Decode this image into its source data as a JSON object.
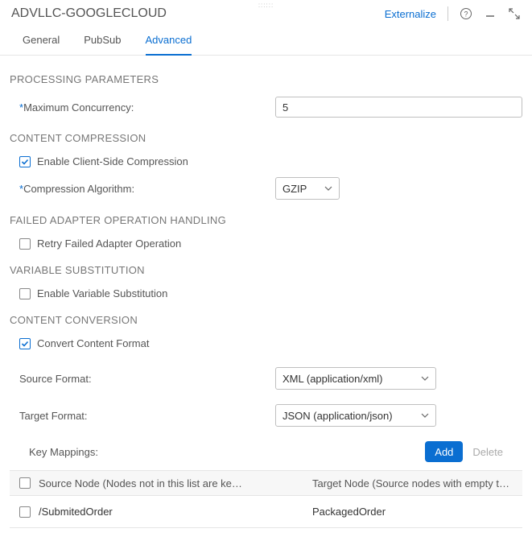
{
  "header": {
    "title": "ADVLLC-GOOGLECLOUD",
    "externalize": "Externalize"
  },
  "tabs": [
    {
      "label": "General"
    },
    {
      "label": "PubSub"
    },
    {
      "label": "Advanced"
    }
  ],
  "sections": {
    "processing_title": "PROCESSING PARAMETERS",
    "max_concurrency_label": "Maximum Concurrency:",
    "max_concurrency_value": "5",
    "compression_title": "CONTENT COMPRESSION",
    "enable_client_compression": "Enable Client-Side Compression",
    "compression_algo_label": "Compression Algorithm:",
    "compression_algo_value": "GZIP",
    "failed_title": "FAILED ADAPTER OPERATION HANDLING",
    "retry_failed": "Retry Failed Adapter Operation",
    "varsub_title": "VARIABLE SUBSTITUTION",
    "enable_varsub": "Enable Variable Substitution",
    "conversion_title": "CONTENT CONVERSION",
    "convert_content": "Convert Content Format",
    "source_format_label": "Source Format:",
    "source_format_value": "XML (application/xml)",
    "target_format_label": "Target Format:",
    "target_format_value": "JSON (application/json)"
  },
  "keymappings": {
    "title": "Key Mappings:",
    "add": "Add",
    "delete": "Delete",
    "col_source": "Source Node (Nodes not in this list are ke…",
    "col_target": "Target Node (Source nodes with empty t…",
    "rows": [
      {
        "source": "/SubmitedOrder",
        "target": "PackagedOrder"
      }
    ]
  }
}
